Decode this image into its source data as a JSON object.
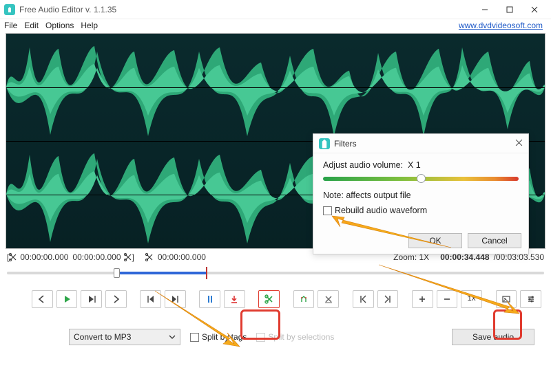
{
  "window": {
    "title": "Free Audio Editor v. 1.1.35"
  },
  "menu": {
    "file": "File",
    "edit": "Edit",
    "options": "Options",
    "help": "Help",
    "link": "www.dvdvideosoft.com"
  },
  "timebar": {
    "sel_start": "00:00:00.000",
    "sel_end": "00:00:00.000",
    "cursor": "00:00:00.000",
    "zoom_label": "Zoom: 1X",
    "current": "00:00:34.448",
    "sep": " / ",
    "total": "00:03:03.530"
  },
  "toolbar": {
    "zoom1x": "1X"
  },
  "bottom": {
    "convert": "Convert to MP3",
    "split_tags": "Split by tags",
    "split_sel": "Split by selections",
    "save": "Save audio"
  },
  "popup": {
    "title": "Filters",
    "label": "Adjust audio volume:",
    "value": "X 1",
    "note": "Note: affects output file",
    "rebuild": "Rebuild audio waveform",
    "ok": "OK",
    "cancel": "Cancel"
  }
}
